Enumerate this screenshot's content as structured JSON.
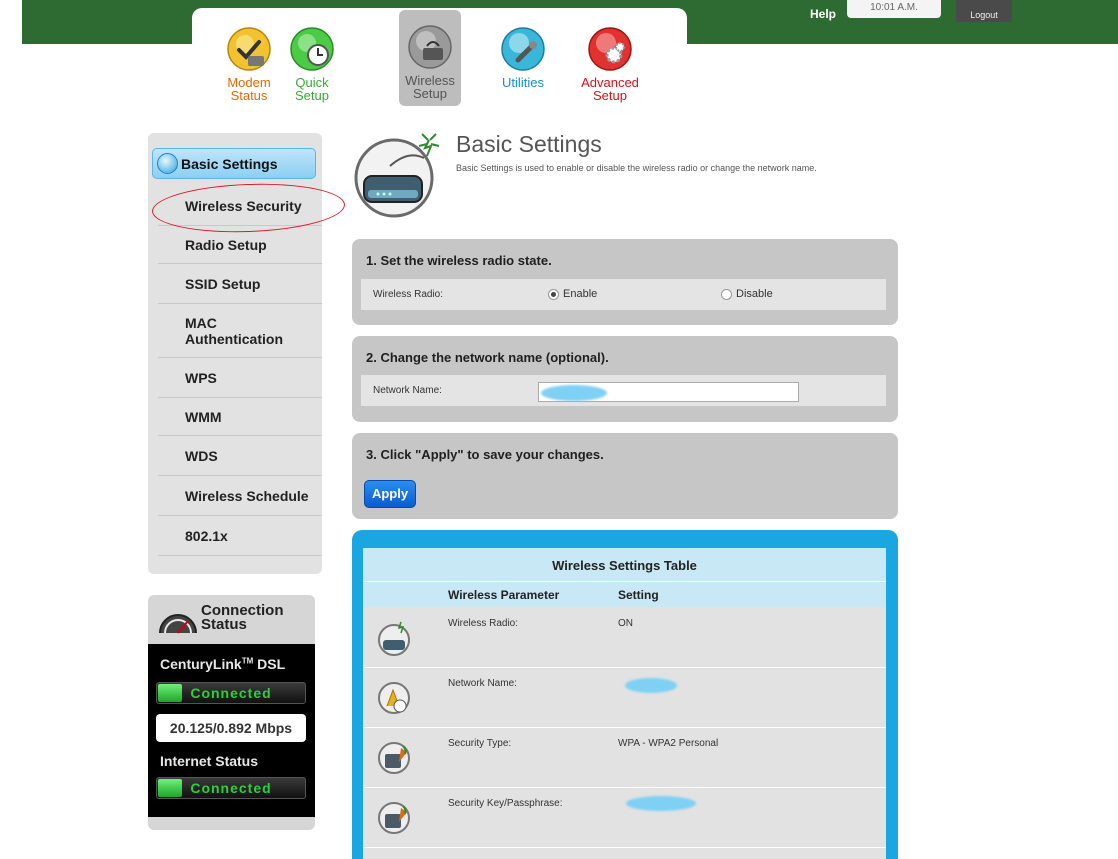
{
  "header": {
    "help_label": "Help",
    "time": "10:01 A.M.",
    "logout_label": "Logout"
  },
  "nav": {
    "items": [
      {
        "label": "Modem\nStatus",
        "icon": "modem-status-icon"
      },
      {
        "label": "Quick\nSetup",
        "icon": "quick-setup-icon"
      },
      {
        "label": "Wireless\nSetup",
        "icon": "wireless-setup-icon"
      },
      {
        "label": "Utilities",
        "icon": "utilities-icon"
      },
      {
        "label": "Advanced\nSetup",
        "icon": "advanced-setup-icon"
      }
    ],
    "active": "Wireless\nSetup"
  },
  "sidebar": {
    "items": [
      {
        "label": "Basic Settings"
      },
      {
        "label": "Wireless Security"
      },
      {
        "label": "Radio Setup"
      },
      {
        "label": "SSID Setup"
      },
      {
        "label": "MAC\nAuthentication"
      },
      {
        "label": "WPS"
      },
      {
        "label": "WMM"
      },
      {
        "label": "WDS"
      },
      {
        "label": "Wireless Schedule"
      },
      {
        "label": "802.1x"
      }
    ],
    "active": "Basic Settings",
    "highlighted": "Wireless Security"
  },
  "connection": {
    "title": "Connection\nStatus",
    "dsl_label": "CenturyLink",
    "dsl_tm": "TM",
    "dsl_suffix": "DSL",
    "dsl_status": "Connected",
    "speed": "20.125/0.892 Mbps",
    "internet_label": "Internet Status",
    "internet_status": "Connected",
    "status_color": "#2ccf3a"
  },
  "page": {
    "title": "Basic Settings",
    "description": "Basic Settings is used to enable or disable the wireless radio or change the network name."
  },
  "step1": {
    "title": "1. Set the wireless radio state.",
    "label": "Wireless Radio:",
    "enable_label": "Enable",
    "disable_label": "Disable",
    "selected": "Enable"
  },
  "step2": {
    "title": "2. Change the network name (optional).",
    "label": "Network Name:"
  },
  "step3": {
    "title": "3. Click \"Apply\" to save your changes.",
    "apply_label": "Apply"
  },
  "table": {
    "title": "Wireless Settings Table",
    "col_param": "Wireless Parameter",
    "col_setting": "Setting",
    "rows": [
      {
        "param": "Wireless Radio:",
        "value": "ON",
        "icon": "router-icon"
      },
      {
        "param": "Network Name:",
        "value": "",
        "icon": "network-name-icon"
      },
      {
        "param": "Security Type:",
        "value": "WPA - WPA2 Personal",
        "icon": "security-icon"
      },
      {
        "param": "Security Key/Passphrase:",
        "value": "",
        "icon": "key-icon"
      }
    ]
  },
  "colors": {
    "topbar": "#2e6b33",
    "accent_blue": "#1aa6e0",
    "apply_blue": "#0a5bd0",
    "annotation_red": "#d71e28"
  }
}
